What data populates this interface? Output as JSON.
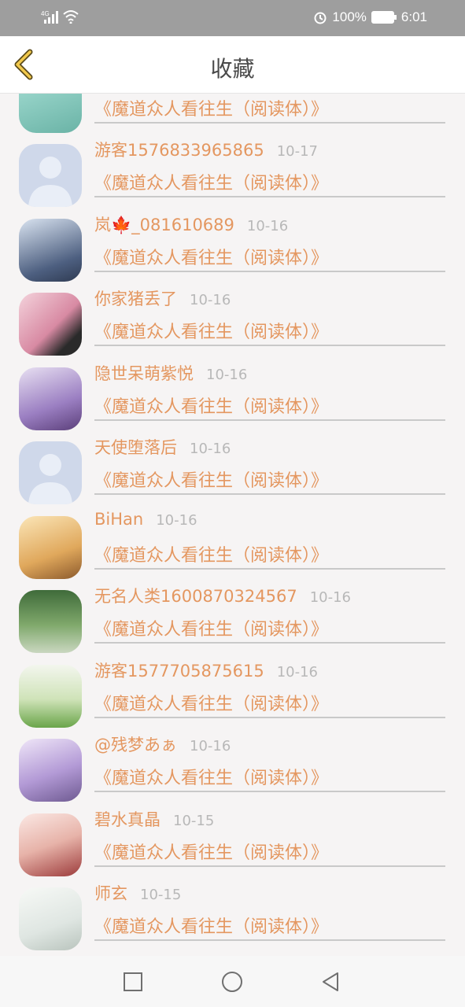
{
  "status": {
    "network": "4G",
    "battery": "100%",
    "time": "6:01"
  },
  "header": {
    "title": "收藏"
  },
  "items": [
    {
      "name": "",
      "date": "",
      "book": "《魔道众人看往生（阅读体）》",
      "avatar_color": "#7cc3b8"
    },
    {
      "name": "游客1576833965865",
      "date": "10-17",
      "book": "《魔道众人看往生（阅读体）》",
      "avatar_color": "#cfd8ea"
    },
    {
      "name": "岚🍁_081610689",
      "date": "10-16",
      "book": "《魔道众人看往生（阅读体）》",
      "avatar_color": "#5f6f8c"
    },
    {
      "name": "你家猪丢了",
      "date": "10-16",
      "book": "《魔道众人看往生（阅读体）》",
      "avatar_color": "#e6b4c7"
    },
    {
      "name": "隐世呆萌紫悦",
      "date": "10-16",
      "book": "《魔道众人看往生（阅读体）》",
      "avatar_color": "#b39ad0"
    },
    {
      "name": "天使堕落后",
      "date": "10-16",
      "book": "《魔道众人看往生（阅读体）》",
      "avatar_color": "#cfd8ea"
    },
    {
      "name": "BiHan",
      "date": "10-16",
      "book": "《魔道众人看往生（阅读体）》",
      "avatar_color": "#e9c07a"
    },
    {
      "name": "无名人类1600870324567",
      "date": "10-16",
      "book": "《魔道众人看往生（阅读体）》",
      "avatar_color": "#5c8a52"
    },
    {
      "name": "游客1577705875615",
      "date": "10-16",
      "book": "《魔道众人看往生（阅读体）》",
      "avatar_color": "#9ec87d"
    },
    {
      "name": "@残梦あぁ",
      "date": "10-16",
      "book": "《魔道众人看往生（阅读体）》",
      "avatar_color": "#b9a6d9"
    },
    {
      "name": "碧水真晶",
      "date": "10-15",
      "book": "《魔道众人看往生（阅读体）》",
      "avatar_color": "#e6c0b8"
    },
    {
      "name": "师玄",
      "date": "10-15",
      "book": "《魔道众人看往生（阅读体）》",
      "avatar_color": "#dfe6e2"
    }
  ],
  "colors": {
    "accent": "#e49760",
    "date": "#b8b8b8",
    "divider": "#c9c9c9",
    "back_icon": "#f2c94c"
  },
  "icons": {
    "back": "chevron-left-icon",
    "nav_square": "recents-square-icon",
    "nav_circle": "home-circle-icon",
    "nav_triangle": "back-triangle-icon"
  }
}
